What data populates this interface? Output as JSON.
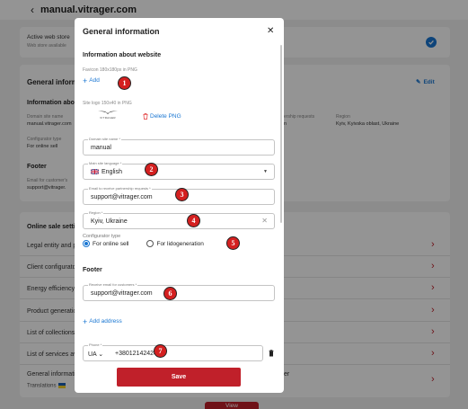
{
  "background": {
    "back_label": "manual.vitrager.com",
    "active_store_title": "Active web store",
    "active_store_sub": "Web store available",
    "general_title": "General inform",
    "edit_label": "Edit",
    "info_about": "Information abou",
    "domain_label": "Domain site name",
    "domain_value": "manual.vitrager.com",
    "partnership_label": "ership requests",
    "partnership_value": "n",
    "region_label": "Region",
    "region_value": "Kyiv, Kyivska oblast, Ukraine",
    "configurator_label": "Configurator type",
    "configurator_value": "For online sell",
    "footer_title": "Footer",
    "footer_email_label": "Email for customer's",
    "footer_email_value": "support@vitrager.",
    "online_settings": "Online sale settin",
    "rows": [
      {
        "label": "Legal entity and p"
      },
      {
        "label": "Client configurato"
      },
      {
        "label": "Energy efficiency"
      },
      {
        "label": "Product generatic"
      },
      {
        "label": "List of collections"
      },
      {
        "label": "List of services av"
      }
    ],
    "general_info_row": "General informatio",
    "translations": "Translations",
    "row_right_fragment": "er",
    "view_button": "View"
  },
  "modal": {
    "title": "General information",
    "section_website": "Information about website",
    "favicon_hint": "Favicon 180x180px in PNG",
    "add_label": "Add",
    "logo_hint": "Site logo 150x40 in PNG",
    "logo_word": "VITRAGER",
    "delete_png": "Delete PNG",
    "domain_field": {
      "label": "Domain site name *",
      "value": "manual"
    },
    "language_field": {
      "label": "Main site language *",
      "value": "English"
    },
    "partnership_field": {
      "label": "Email to receive partnership requests *",
      "value": "support@vitrager.com"
    },
    "region_field": {
      "label": "Region *",
      "value": "Kyiv, Ukraine"
    },
    "configurator_label": "Configurator type",
    "radio_online": "For online sell",
    "radio_lead": "For lidogeneration",
    "footer_title": "Footer",
    "footer_email_field": {
      "label": "Receive email for customers *",
      "value": "support@vitrager.com"
    },
    "add_address": "Add address",
    "phone_field": {
      "label": "Phone *",
      "code": "UA",
      "number": "+38012142424"
    },
    "save_label": "Save"
  },
  "markers": [
    "1",
    "2",
    "3",
    "4",
    "5",
    "6",
    "7"
  ],
  "colors": {
    "accent_red": "#c0202a",
    "link_blue": "#1976d2",
    "marker_red": "#d42020"
  }
}
